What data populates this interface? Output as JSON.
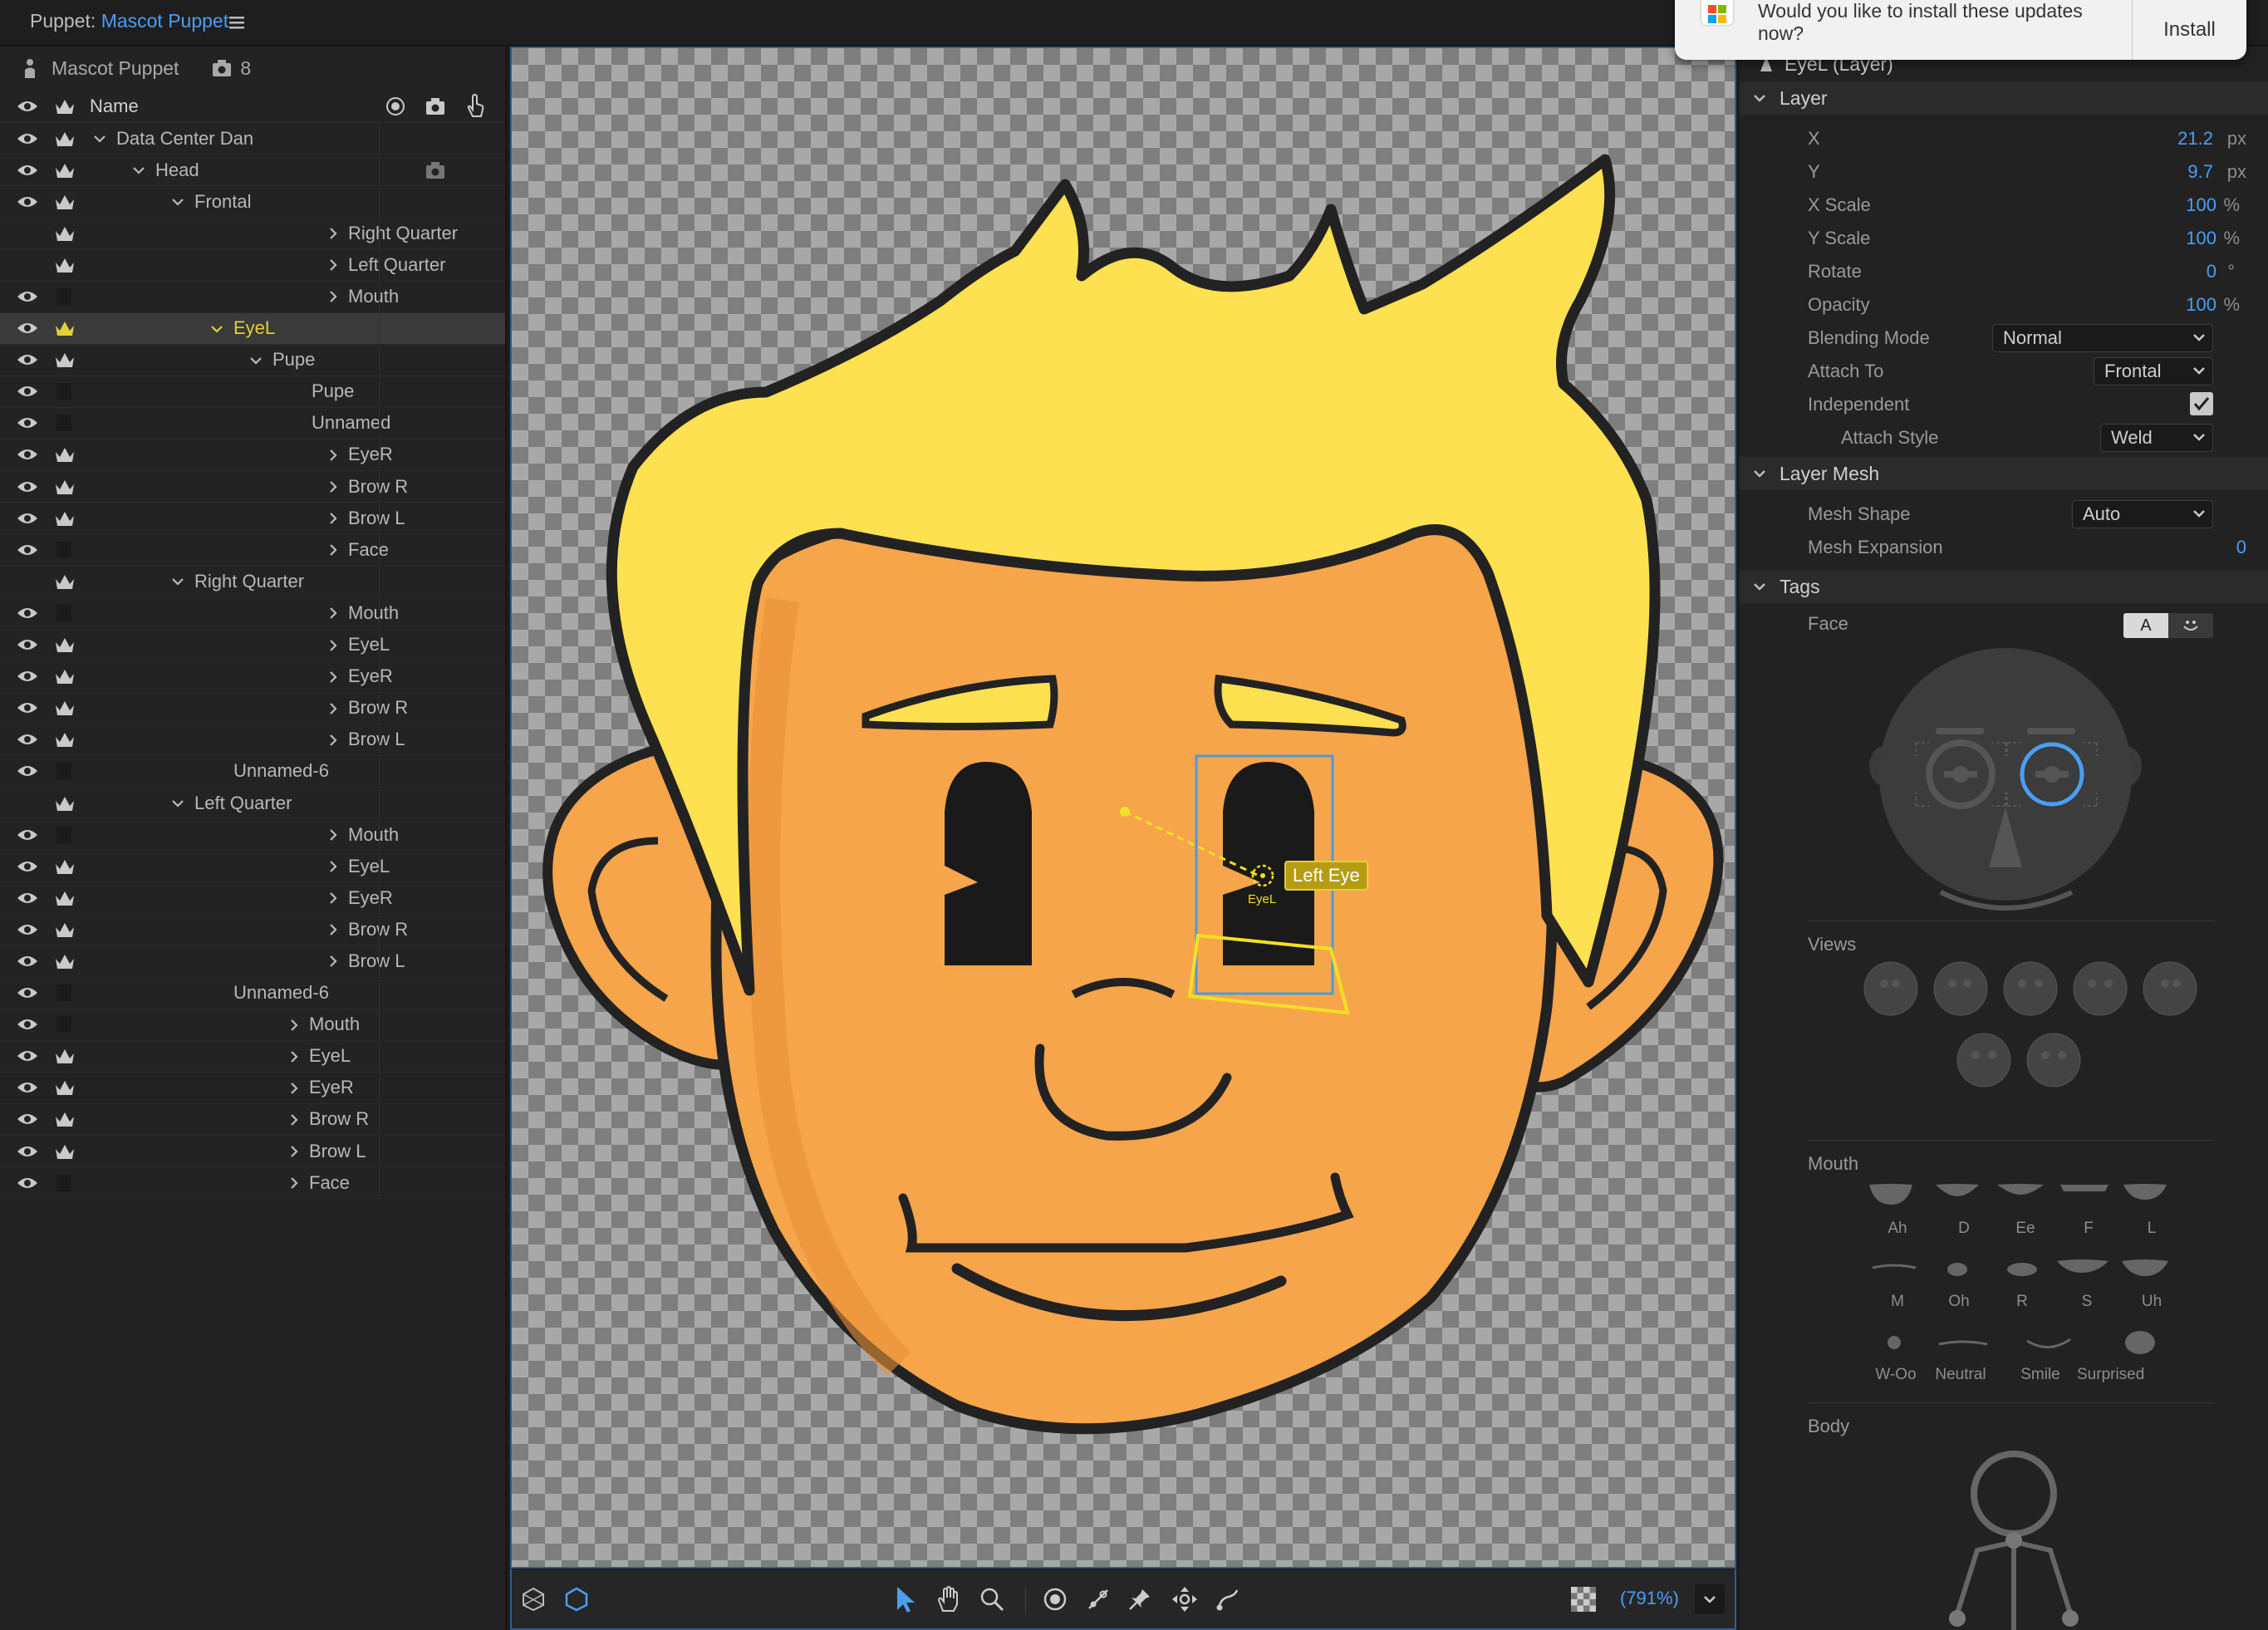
{
  "topbar": {
    "prefix": "Puppet:",
    "name": "Mascot Puppet"
  },
  "left_panel": {
    "puppet_name": "Mascot Puppet",
    "puppet_count": "8",
    "col_name": "Name",
    "rows": [
      {
        "label": "Data Center Dan",
        "depth": 0,
        "chevron": "down",
        "eye": true,
        "crown": true
      },
      {
        "label": "Head",
        "depth": 1,
        "chevron": "down",
        "eye": true,
        "crown": true
      },
      {
        "label": "Frontal",
        "depth": 2,
        "chevron": "down",
        "eye": true,
        "crown": true
      },
      {
        "label": "Right Quarter",
        "depth": 3,
        "chevron": "right",
        "eye": false,
        "crown": true
      },
      {
        "label": "Left Quarter",
        "depth": 3,
        "chevron": "right",
        "eye": false,
        "crown": true
      },
      {
        "label": "Mouth",
        "depth": 3,
        "chevron": "right",
        "eye": true,
        "crown": false
      },
      {
        "label": "EyeL",
        "depth": 3,
        "chevron": "down",
        "eye": true,
        "crown": true,
        "selected": true
      },
      {
        "label": "Pupe",
        "depth": 4,
        "chevron": "down",
        "eye": true,
        "crown": true
      },
      {
        "label": "Pupe",
        "depth": 5,
        "chevron": "none",
        "eye": true,
        "crown": false
      },
      {
        "label": "Unnamed",
        "depth": 5,
        "chevron": "none",
        "eye": true,
        "crown": false
      },
      {
        "label": "EyeR",
        "depth": 3,
        "chevron": "right",
        "eye": true,
        "crown": true
      },
      {
        "label": "Brow R",
        "depth": 3,
        "chevron": "right",
        "eye": true,
        "crown": true
      },
      {
        "label": "Brow L",
        "depth": 3,
        "chevron": "right",
        "eye": true,
        "crown": true
      },
      {
        "label": "Face",
        "depth": 3,
        "chevron": "right",
        "eye": true,
        "crown": false
      },
      {
        "label": "Right Quarter",
        "depth": 2,
        "chevron": "down",
        "eye": false,
        "crown": true
      },
      {
        "label": "Mouth",
        "depth": 3,
        "chevron": "right",
        "eye": true,
        "crown": false
      },
      {
        "label": "EyeL",
        "depth": 3,
        "chevron": "right",
        "eye": true,
        "crown": true
      },
      {
        "label": "EyeR",
        "depth": 3,
        "chevron": "right",
        "eye": true,
        "crown": true
      },
      {
        "label": "Brow R",
        "depth": 3,
        "chevron": "right",
        "eye": true,
        "crown": true
      },
      {
        "label": "Brow L",
        "depth": 3,
        "chevron": "right",
        "eye": true,
        "crown": true
      },
      {
        "label": "Unnamed-6",
        "depth": 3,
        "chevron": "none",
        "eye": true,
        "crown": false
      },
      {
        "label": "Left Quarter",
        "depth": 2,
        "chevron": "down",
        "eye": false,
        "crown": true
      },
      {
        "label": "Mouth",
        "depth": 3,
        "chevron": "right",
        "eye": true,
        "crown": false
      },
      {
        "label": "EyeL",
        "depth": 3,
        "chevron": "right",
        "eye": true,
        "crown": true
      },
      {
        "label": "EyeR",
        "depth": 3,
        "chevron": "right",
        "eye": true,
        "crown": true
      },
      {
        "label": "Brow R",
        "depth": 3,
        "chevron": "right",
        "eye": true,
        "crown": true
      },
      {
        "label": "Brow L",
        "depth": 3,
        "chevron": "right",
        "eye": true,
        "crown": true
      },
      {
        "label": "Unnamed-6",
        "depth": 3,
        "chevron": "none",
        "eye": true,
        "crown": false
      },
      {
        "label": "Mouth",
        "depth": 2,
        "chevron": "right",
        "eye": true,
        "crown": false
      },
      {
        "label": "EyeL",
        "depth": 2,
        "chevron": "right",
        "eye": true,
        "crown": true
      },
      {
        "label": "EyeR",
        "depth": 2,
        "chevron": "right",
        "eye": true,
        "crown": true
      },
      {
        "label": "Brow R",
        "depth": 2,
        "chevron": "right",
        "eye": true,
        "crown": true
      },
      {
        "label": "Brow L",
        "depth": 2,
        "chevron": "right",
        "eye": true,
        "crown": true
      },
      {
        "label": "Face",
        "depth": 2,
        "chevron": "right",
        "eye": true,
        "crown": false
      }
    ]
  },
  "canvas": {
    "handle_label": "Left Eye",
    "handle_sublabel": "EyeL",
    "zoom": "(791%)"
  },
  "popup": {
    "message": "Would you like to install these updates now?",
    "button": "Install"
  },
  "properties": {
    "title": "EyeL (Layer)",
    "layer_section": "Layer",
    "x_label": "X",
    "x_value": "21.2",
    "x_unit": "px",
    "y_label": "Y",
    "y_value": "9.7",
    "y_unit": "px",
    "xscale_label": "X Scale",
    "xscale_value": "100",
    "xscale_unit": "%",
    "yscale_label": "Y Scale",
    "yscale_value": "100",
    "yscale_unit": "%",
    "rotate_label": "Rotate",
    "rotate_value": "0",
    "rotate_unit": "°",
    "opacity_label": "Opacity",
    "opacity_value": "100",
    "opacity_unit": "%",
    "blending_label": "Blending Mode",
    "blending_value": "Normal",
    "attach_to_label": "Attach To",
    "attach_to_value": "Frontal",
    "independent_label": "Independent",
    "independent_checked": true,
    "attach_style_label": "Attach Style",
    "attach_style_value": "Weld",
    "mesh_section": "Layer Mesh",
    "mesh_shape_label": "Mesh Shape",
    "mesh_shape_value": "Auto",
    "mesh_expansion_label": "Mesh Expansion",
    "mesh_expansion_value": "0",
    "tags_section": "Tags",
    "face_label": "Face",
    "face_btn_a": "A",
    "views_label": "Views",
    "mouth_label": "Mouth",
    "mouth_shapes": [
      "Ah",
      "D",
      "Ee",
      "F",
      "L",
      "M",
      "Oh",
      "R",
      "S",
      "Uh",
      "W-Oo",
      "Neutral",
      "Smile",
      "Surprised"
    ],
    "body_label": "Body"
  },
  "colors": {
    "accent": "#4a9ff5",
    "selection": "#e2cf3a",
    "skin": "#f7a54a",
    "hair": "#fde150"
  }
}
